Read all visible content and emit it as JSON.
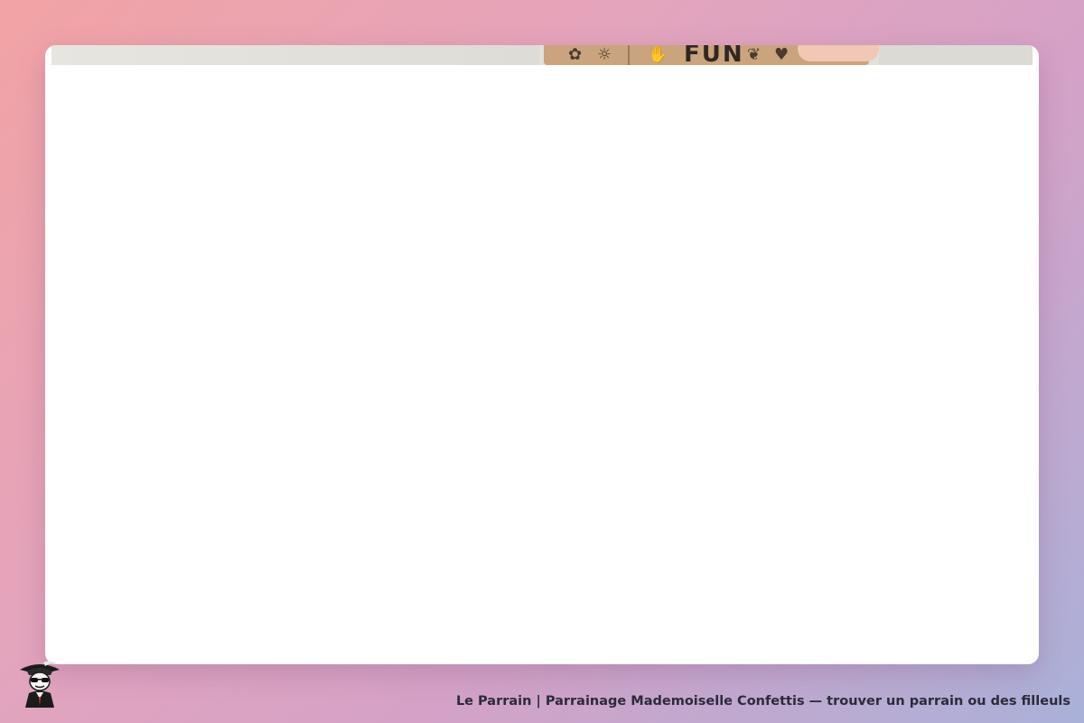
{
  "hero": {
    "box_text": "FUN",
    "image_icon": "gift-box-photo"
  },
  "footer": {
    "caption": "Le Parrain | Parrainage Mademoiselle Confettis — trouver un parrain ou des filleuls",
    "mascot_icon": "mascot-icon"
  },
  "colors": {
    "background_start": "#f2a3a4",
    "background_end": "#a9b1d9",
    "card": "#ffffff",
    "caption_text": "#2b2b3a"
  }
}
